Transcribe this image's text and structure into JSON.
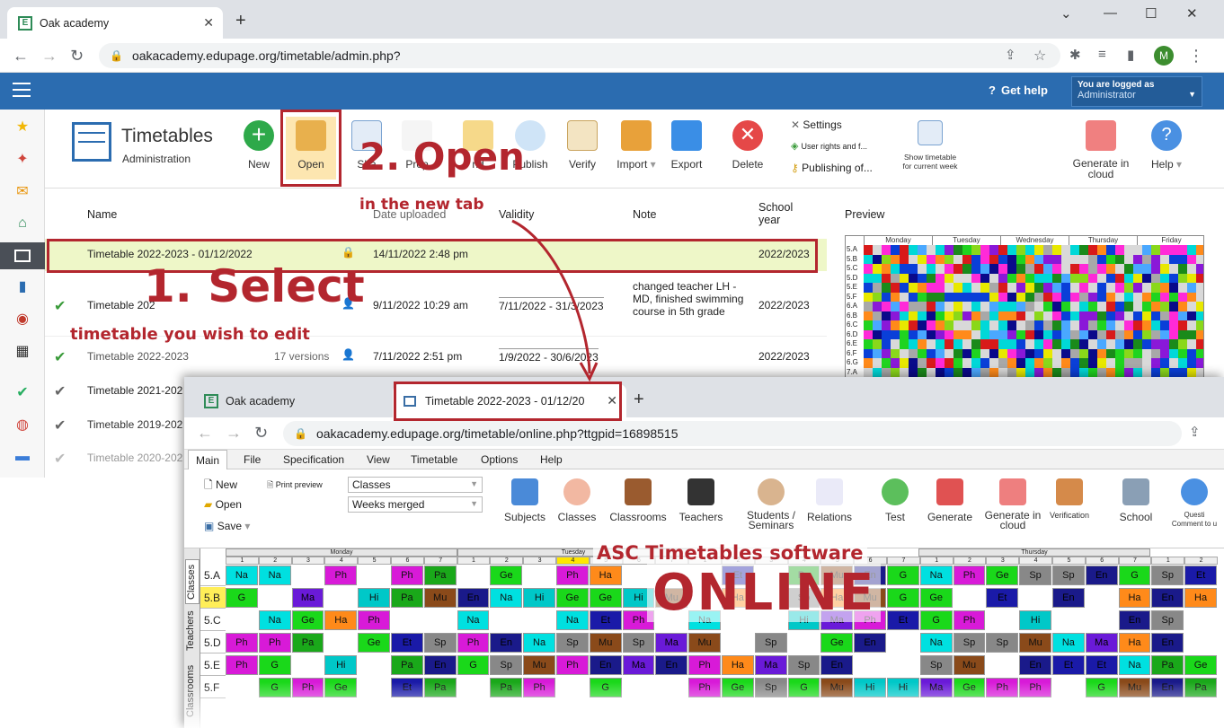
{
  "browser": {
    "tab_title": "Oak academy",
    "url": "oakacademy.edupage.org/timetable/admin.php?",
    "avatar_letter": "M"
  },
  "app": {
    "get_help": "Get help",
    "logged_as_label": "You are logged as",
    "logged_as_user": "Administrator",
    "title": "Timetables",
    "subtitle": "Administration"
  },
  "toolbar": {
    "new": "New",
    "open": "Open",
    "share": "Sha",
    "properties": "Prop",
    "send": "nd",
    "publish": "Publish",
    "verify": "Verify",
    "import": "Import",
    "export": "Export",
    "delete": "Delete",
    "settings": "Settings",
    "user_rights": "User rights and f...",
    "publishing": "Publishing of...",
    "show_timetable": "Show timetable for current week",
    "generate_cloud": "Generate in cloud",
    "help": "Help"
  },
  "list": {
    "headers": {
      "name": "Name",
      "date_uploaded": "Date uploaded",
      "validity": "Validity",
      "note": "Note",
      "school_year": "School year",
      "preview": "Preview"
    },
    "rows": [
      {
        "name": "Timetable 2022-2023 - 01/12/2022",
        "date": "14/11/2022 2:48 pm",
        "validity": "",
        "note": "",
        "year": "2022/2023"
      },
      {
        "name": "Timetable 202",
        "date": "9/11/2022 10:29 am",
        "validity": "7/11/2022 - 31/3/2023",
        "note": "changed teacher LH - MD, finished swimming course in 5th grade",
        "year": "2022/2023"
      },
      {
        "name": "Timetable 2022-2023",
        "versions": "17 versions",
        "date": "7/11/2022 2:51 pm",
        "validity": "1/9/2022 - 30/6/2023",
        "note": "",
        "year": "2022/2023"
      },
      {
        "name": "Timetable 2021-202"
      },
      {
        "name": "Timetable 2019-202"
      },
      {
        "name": "Timetable 2020-202"
      }
    ]
  },
  "preview": {
    "days": [
      "Monday",
      "Tuesday",
      "Wednesday",
      "Thursday",
      "Friday"
    ],
    "classes": [
      "5.A",
      "5.B",
      "5.C",
      "5.D",
      "5.E",
      "5.F",
      "6.A",
      "6.B",
      "6.C",
      "6.D",
      "6.E",
      "6.F",
      "6.G",
      "7.A"
    ]
  },
  "window2": {
    "tab1": "Oak academy",
    "tab2": "Timetable 2022-2023 - 01/12/20",
    "url": "oakacademy.edupage.org/timetable/online.php?ttgpid=16898515",
    "menu": [
      "Main",
      "File",
      "Specification",
      "View",
      "Timetable",
      "Options",
      "Help"
    ],
    "tools": {
      "new": "New",
      "open": "Open",
      "save": "Save",
      "print_preview": "Print preview",
      "select1": "Classes",
      "select2": "Weeks merged",
      "subjects": "Subjects",
      "classes": "Classes",
      "classrooms": "Classrooms",
      "teachers": "Teachers",
      "students": "Students / Seminars",
      "relations": "Relations",
      "test": "Test",
      "generate": "Generate",
      "generate_cloud": "Generate in cloud",
      "verification": "Verification",
      "school": "School",
      "questions": "Questi Comment to u"
    },
    "side_tabs": [
      "Classes",
      "Teachers",
      "Classrooms"
    ],
    "days": [
      "Monday",
      "Tuesday",
      "Thursday"
    ],
    "periods": [
      "1",
      "2",
      "3",
      "4",
      "5",
      "6",
      "7"
    ],
    "rows": [
      "5.A",
      "5.B",
      "5.C",
      "5.D",
      "5.E",
      "5.F"
    ]
  },
  "annotations": {
    "open": "2. Open",
    "open_sub": "in the new tab",
    "select": "1. Select",
    "select_sub": "timetable you wish to edit",
    "asc": "ASC Timetables software",
    "online": "ONLINE"
  },
  "colors": {
    "accent_red": "#b3262e",
    "header_blue": "#2b6cb0",
    "selected_row": "#eef7c8"
  }
}
